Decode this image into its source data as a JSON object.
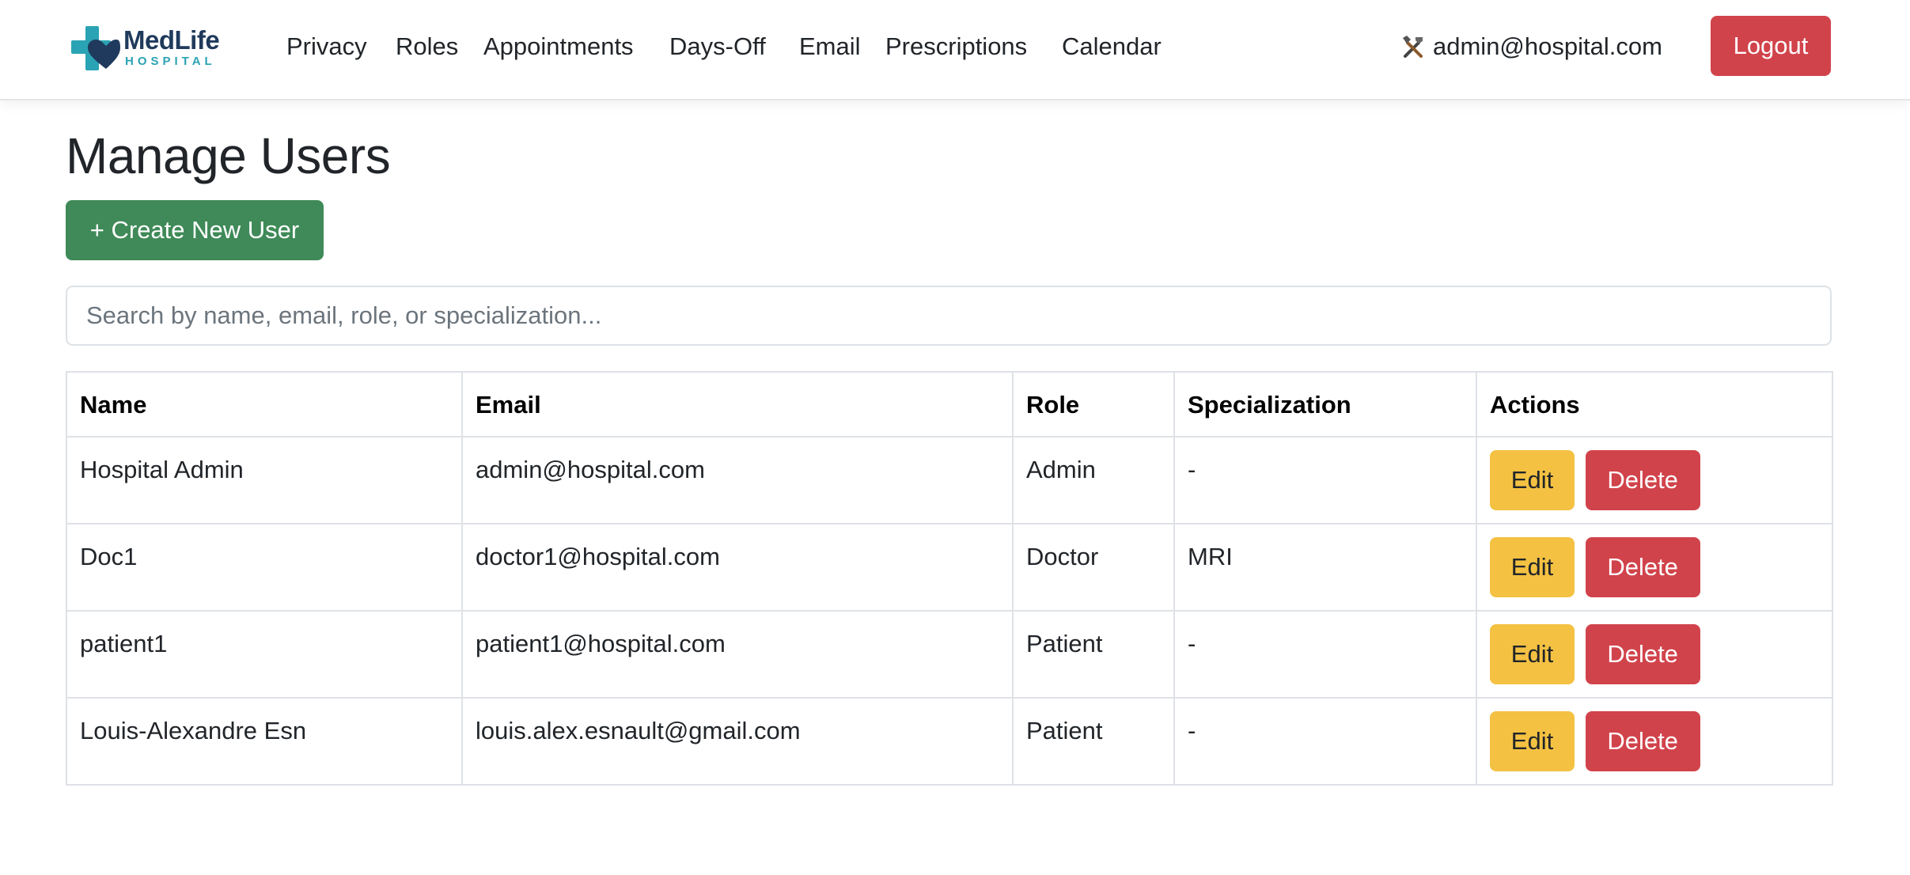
{
  "brand": {
    "name": "MedLife",
    "subtitle": "HOSPITAL",
    "icon": "cross-heart-logo"
  },
  "nav": {
    "links": [
      "Privacy",
      "Roles",
      "Appointments",
      "Days-Off",
      "Email",
      "Prescriptions",
      "Calendar"
    ],
    "user_icon": "tools-icon",
    "user_email": "admin@hospital.com",
    "logout_label": "Logout"
  },
  "page": {
    "title": "Manage Users",
    "create_label": "+ Create New User",
    "search_placeholder": "Search by name, email, role, or specialization...",
    "search_value": ""
  },
  "table": {
    "headers": [
      "Name",
      "Email",
      "Role",
      "Specialization",
      "Actions"
    ],
    "rows": [
      {
        "name": "Hospital Admin",
        "email": "admin@hospital.com",
        "role": "Admin",
        "specialization": "-"
      },
      {
        "name": "Doc1",
        "email": "doctor1@hospital.com",
        "role": "Doctor",
        "specialization": "MRI"
      },
      {
        "name": "patient1",
        "email": "patient1@hospital.com",
        "role": "Patient",
        "specialization": "-"
      },
      {
        "name": "Louis-Alexandre Esn",
        "email": "louis.alex.esnault@gmail.com",
        "role": "Patient",
        "specialization": "-"
      }
    ],
    "edit_label": "Edit",
    "delete_label": "Delete"
  },
  "colors": {
    "brand_navy": "#1f3a5c",
    "brand_teal": "#2aa3b4",
    "danger": "#d1434b",
    "success": "#3f8a58",
    "warning": "#f4c142"
  }
}
